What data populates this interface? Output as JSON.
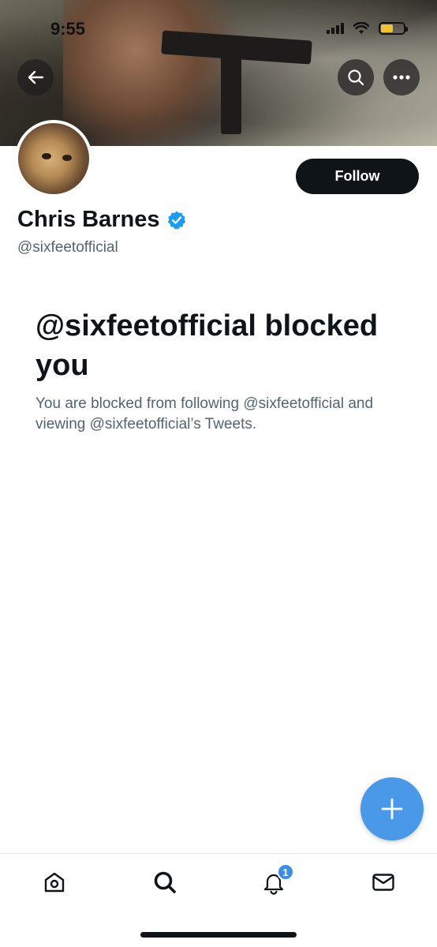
{
  "status_bar": {
    "time": "9:55",
    "battery_color": "#f2c230"
  },
  "header": {
    "back_icon": "arrow-left-icon",
    "search_icon": "search-icon",
    "more_icon": "more-horizontal-icon"
  },
  "profile": {
    "display_name": "Chris Barnes",
    "handle": "@sixfeetofficial",
    "verified": true,
    "follow_label": "Follow"
  },
  "blocked": {
    "title": "@sixfeetofficial blocked you",
    "message": "You are blocked from following @sixfeetofficial and viewing @sixfeetofficial’s Tweets."
  },
  "fab": {
    "icon": "plus-icon",
    "color": "#4a99e9"
  },
  "bottom_nav": {
    "items": [
      {
        "icon": "home-icon"
      },
      {
        "icon": "search-icon"
      },
      {
        "icon": "notifications-bell-icon",
        "badge": "1"
      },
      {
        "icon": "messages-envelope-icon"
      }
    ]
  },
  "colors": {
    "primary_text": "#0f1419",
    "secondary_text": "#536471",
    "accent": "#1d9bf0"
  }
}
